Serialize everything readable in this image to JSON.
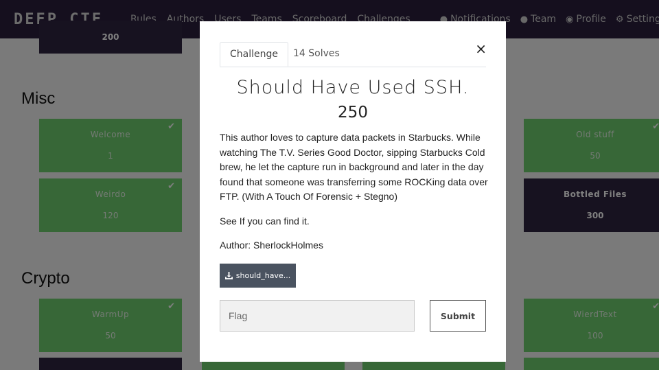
{
  "navbar": {
    "brand": "DEEP CTF",
    "links": [
      "Rules",
      "Authors",
      "Users",
      "Teams",
      "Scoreboard",
      "Challenges"
    ],
    "notifications": "Notifications",
    "team": "Team",
    "profile": "Profile",
    "settings": "Settings"
  },
  "board": {
    "top_tile_value": "200",
    "sections": [
      {
        "title": "Misc"
      },
      {
        "title": "Crypto"
      }
    ],
    "tiles": [
      {
        "name": "Welcome",
        "value": "1"
      },
      {
        "name": "Weirdo",
        "value": "120"
      },
      {
        "name": "Old stuff",
        "value": "50"
      },
      {
        "name": "Bottled Files",
        "value": "300"
      },
      {
        "name": "WarmUp",
        "value": "50"
      },
      {
        "name": "WierdText",
        "value": "100"
      }
    ]
  },
  "modal": {
    "tabs": [
      "Challenge",
      "14 Solves"
    ],
    "close": "×",
    "title": "Should Have Used SSH.",
    "value": "250",
    "description": [
      "This author loves to capture data packets in Starbucks. While watching The T.V. Series Good Doctor, sipping Starbucks Cold brew, he let the capture run in background and later in the day found that someone was transferring some ROCKing data over FTP. (With A Touch Of Forensic + Stegno)",
      "See If you can find it.",
      "Author: SherlockHolmes"
    ],
    "file": "should_have...",
    "flag_placeholder": "Flag",
    "submit": "Submit"
  }
}
